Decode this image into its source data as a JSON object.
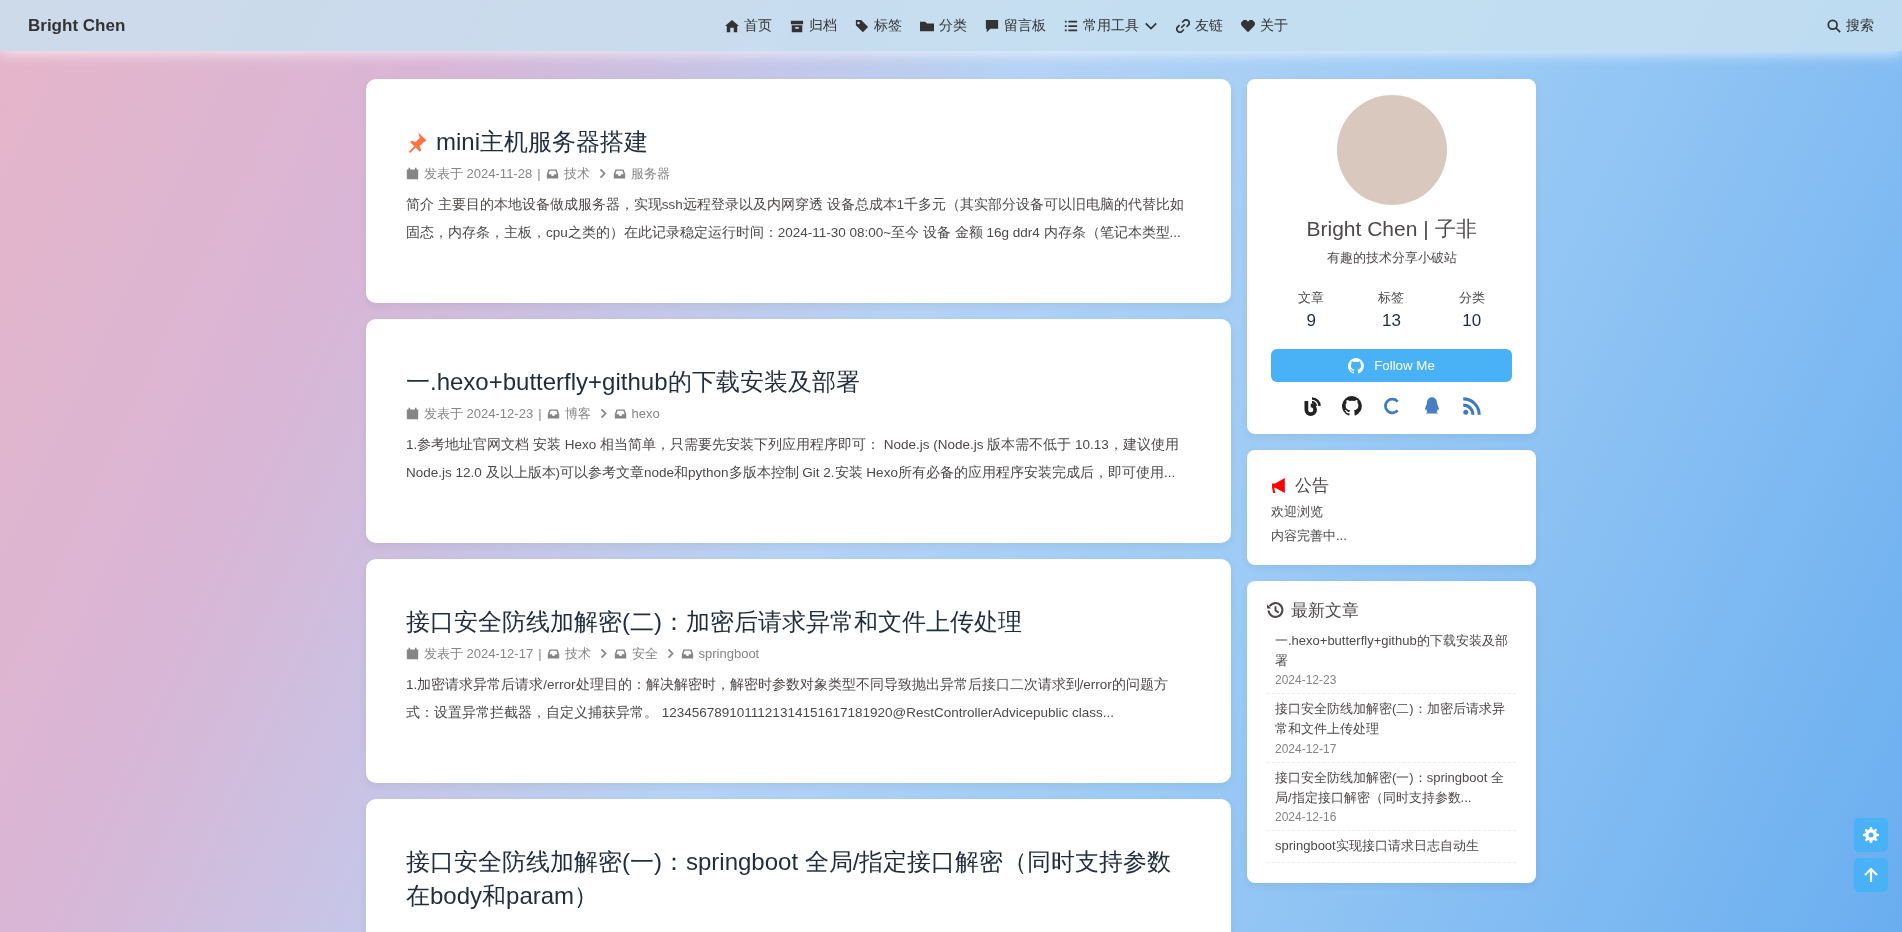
{
  "nav": {
    "brand": "Bright Chen",
    "items": [
      {
        "label": "首页",
        "dropdown": false
      },
      {
        "label": "归档",
        "dropdown": false
      },
      {
        "label": "标签",
        "dropdown": false
      },
      {
        "label": "分类",
        "dropdown": false
      },
      {
        "label": "留言板",
        "dropdown": false
      },
      {
        "label": "常用工具",
        "dropdown": true
      },
      {
        "label": "友链",
        "dropdown": false
      },
      {
        "label": "关于",
        "dropdown": false
      }
    ],
    "search": "搜索"
  },
  "posts": [
    {
      "pinned": true,
      "title": "mini主机服务器搭建",
      "date": "发表于 2024-11-28",
      "separator": "|",
      "categories": [
        "技术",
        "服务器"
      ],
      "excerpt": "简介 主要目的本地设备做成服务器，实现ssh远程登录以及内网穿透 设备总成本1千多元（其实部分设备可以旧电脑的代替比如固态，内存条，主板，cpu之类的）在此记录稳定运行时间：2024-11-30 08:00~至今 设备 金额 16g ddr4 内存条（笔记本类型..."
    },
    {
      "pinned": false,
      "title": "一.hexo+butterfly+github的下载安装及部署",
      "date": "发表于 2024-12-23",
      "separator": "|",
      "categories": [
        "博客",
        "hexo"
      ],
      "excerpt": "1.参考地址官网文档 安装 Hexo 相当简单，只需要先安装下列应用程序即可： Node.js (Node.js 版本需不低于 10.13，建议使用 Node.js 12.0 及以上版本)可以参考文章node和python多版本控制 Git 2.安装 Hexo所有必备的应用程序安装完成后，即可使用..."
    },
    {
      "pinned": false,
      "title": "接口安全防线加解密(二)：加密后请求异常和文件上传处理",
      "date": "发表于 2024-12-17",
      "separator": "|",
      "categories": [
        "技术",
        "安全",
        "springboot"
      ],
      "excerpt": "1.加密请求异常后请求/error处理目的：解决解密时，解密时参数对象类型不同导致抛出异常后接口二次请求到/error的问题方式：设置异常拦截器，自定义捕获异常。 1234567891011121314151617181920@RestControllerAdvicepublic class..."
    },
    {
      "pinned": false,
      "title": "接口安全防线加解密(一)：springboot 全局/指定接口解密（同时支持参数在body和param）"
    }
  ],
  "author": {
    "name": "Bright Chen | 子非",
    "bio": "有趣的技术分享小破站",
    "stats": [
      {
        "label": "文章",
        "value": "9"
      },
      {
        "label": "标签",
        "value": "13"
      },
      {
        "label": "分类",
        "value": "10"
      }
    ],
    "follow": "Follow Me"
  },
  "notice": {
    "title": "公告",
    "lines": [
      "欢迎浏览",
      "内容完善中..."
    ]
  },
  "recent": {
    "title": "最新文章",
    "items": [
      {
        "title": "一.hexo+butterfly+github的下载安装及部署",
        "date": "2024-12-23"
      },
      {
        "title": "接口安全防线加解密(二)：加密后请求异常和文件上传处理",
        "date": "2024-12-17"
      },
      {
        "title": "接口安全防线加解密(一)：springboot 全局/指定接口解密（同时支持参数...",
        "date": "2024-12-16"
      },
      {
        "title": "springboot实现接口请求日志自动生"
      }
    ]
  }
}
